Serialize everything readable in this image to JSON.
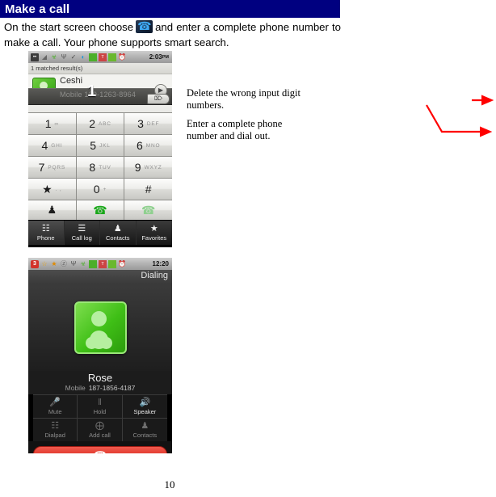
{
  "document": {
    "header_title": "Make a call",
    "body_text_before": "On the start screen choose",
    "body_icon_name": "phone-handset-icon",
    "body_text_after": "and enter a complete phone number to make a call. Your phone supports smart search.",
    "page_number": "10"
  },
  "callouts": [
    {
      "id": "delete",
      "text": "Delete the wrong input digit numbers."
    },
    {
      "id": "dial",
      "text": "Enter a complete phone number and dial out."
    }
  ],
  "dialer_screen": {
    "statusbar": {
      "time": "2:03",
      "ampm": "PM",
      "icons": [
        {
          "name": "sms-icon",
          "glyph": "••••"
        },
        {
          "name": "signal-bars-icon",
          "glyph": "▂"
        },
        {
          "name": "android-robot-icon",
          "glyph": "☗"
        },
        {
          "name": "usb-icon",
          "glyph": "Ψ"
        },
        {
          "name": "sync-check-icon",
          "glyph": "✔"
        },
        {
          "name": "wifi-icon",
          "glyph": "◠"
        },
        {
          "name": "signal-strength-icon",
          "glyph": "█"
        },
        {
          "name": "sim-card-icon",
          "glyph": "T"
        },
        {
          "name": "battery-icon",
          "glyph": "█"
        },
        {
          "name": "alarm-clock-icon",
          "glyph": "⏰"
        }
      ]
    },
    "matched_results": "1 matched result(s)",
    "contact_name": "Ceshi",
    "contact_type": "Mobile",
    "contact_number": "130-1263-8964",
    "typed_digits": "1",
    "expand_icon": "▶",
    "backspace_icon": "⌦",
    "keys": [
      {
        "digit": "1",
        "sub": "∞"
      },
      {
        "digit": "2",
        "sub": "ABC"
      },
      {
        "digit": "3",
        "sub": "DEF"
      },
      {
        "digit": "4",
        "sub": "GHI"
      },
      {
        "digit": "5",
        "sub": "JKL"
      },
      {
        "digit": "6",
        "sub": "MNO"
      },
      {
        "digit": "7",
        "sub": "PQRS"
      },
      {
        "digit": "8",
        "sub": "TUV"
      },
      {
        "digit": "9",
        "sub": "WXYZ"
      },
      {
        "digit": "★",
        "sub": ". ,"
      },
      {
        "digit": "0",
        "sub": "+"
      },
      {
        "digit": "#",
        "sub": ""
      }
    ],
    "action_keys": [
      {
        "name": "add-contact-icon",
        "glyph": "♟"
      },
      {
        "name": "call-sim1-icon",
        "glyph": "☎"
      },
      {
        "name": "call-sim2-icon",
        "glyph": "☎"
      }
    ],
    "tabs": [
      {
        "label": "Phone",
        "icon": "dialpad-icon",
        "glyph": "☷",
        "active": true
      },
      {
        "label": "Call log",
        "icon": "list-icon",
        "glyph": "☰",
        "active": false
      },
      {
        "label": "Contacts",
        "icon": "person-icon",
        "glyph": "♟",
        "active": false
      },
      {
        "label": "Favorites",
        "icon": "star-icon",
        "glyph": "★",
        "active": false
      }
    ]
  },
  "incall_screen": {
    "statusbar": {
      "time": "12:20",
      "badge": "3",
      "icons": [
        {
          "name": "notification-count-badge",
          "glyph": "3"
        },
        {
          "name": "star-outline-icon",
          "glyph": "☆"
        },
        {
          "name": "star-filled-icon",
          "glyph": "★"
        },
        {
          "name": "mute-ring-icon",
          "glyph": "Ⓡ"
        },
        {
          "name": "usb-icon",
          "glyph": "Ψ"
        },
        {
          "name": "android-robot-icon",
          "glyph": "☗"
        },
        {
          "name": "signal-bars-icon",
          "glyph": "█"
        },
        {
          "name": "sim-card-icon",
          "glyph": "T"
        },
        {
          "name": "battery-icon",
          "glyph": "█"
        },
        {
          "name": "alarm-clock-icon",
          "glyph": "⏰"
        }
      ]
    },
    "call_state": "Dialing",
    "contact_name": "Rose",
    "number_label": "Mobile",
    "contact_number": "187-1856-4187",
    "controls": [
      {
        "label": "Mute",
        "icon": "mute-microphone-icon",
        "glyph": "Ἲ4",
        "dim": true
      },
      {
        "label": "Hold",
        "icon": "pause-icon",
        "glyph": "‖",
        "dim": true
      },
      {
        "label": "Speaker",
        "icon": "speaker-icon",
        "glyph": "ὐA",
        "dim": false
      },
      {
        "label": "Dialpad",
        "icon": "dialpad-icon",
        "glyph": "☷",
        "dim": true
      },
      {
        "label": "Add call",
        "icon": "add-call-icon",
        "glyph": "⊕",
        "dim": true
      },
      {
        "label": "Contacts",
        "icon": "person-icon",
        "glyph": "♟",
        "dim": true
      }
    ],
    "end_call_icon": "☎"
  },
  "colors": {
    "header_blue": "#000080",
    "arrow_red": "#ff0000",
    "end_call_red": "#e0362a",
    "accent_green": "#3fbf16"
  }
}
